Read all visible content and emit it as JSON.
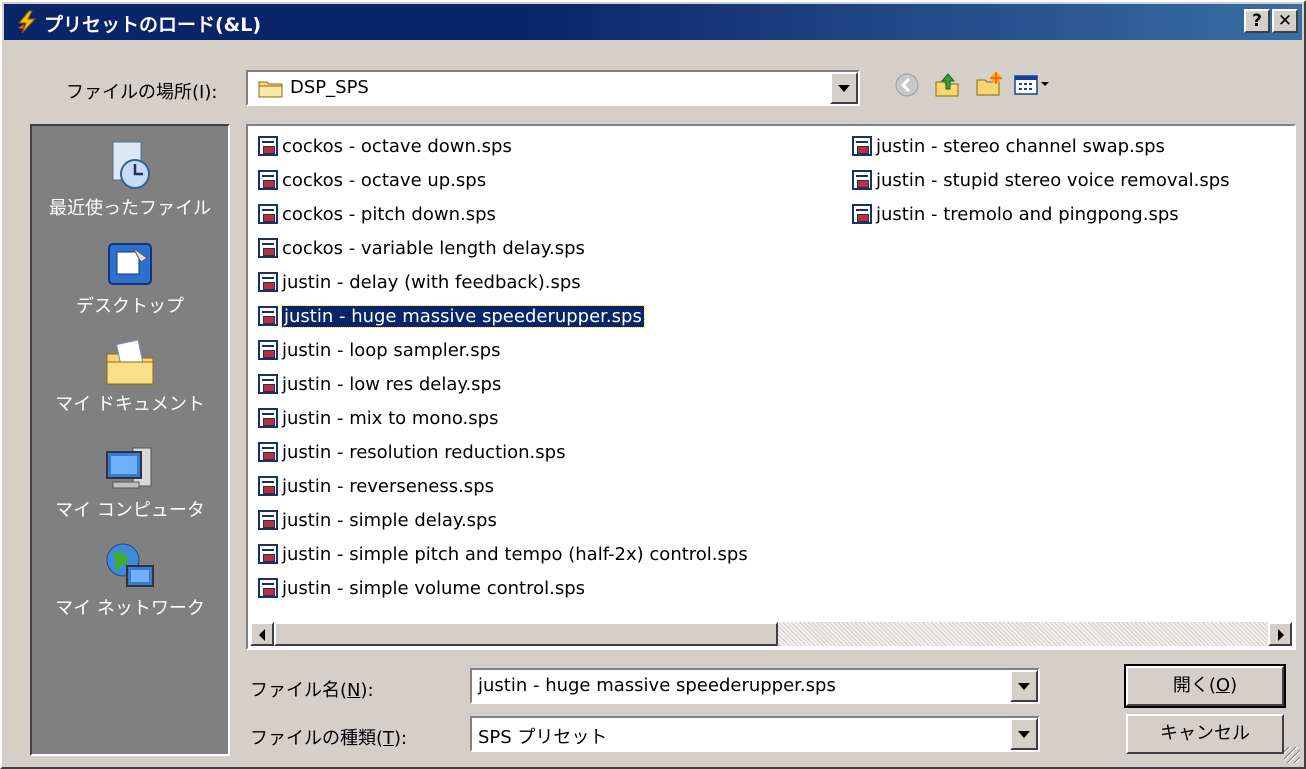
{
  "window": {
    "title": "プリセットのロード(&L)",
    "help_btn": "?",
    "close_btn": "✕"
  },
  "look_in": {
    "label": "ファイルの場所(I):",
    "value": "DSP_SPS"
  },
  "places": [
    {
      "label": "最近使ったファイル",
      "icon": "recent-files-icon"
    },
    {
      "label": "デスクトップ",
      "icon": "desktop-icon"
    },
    {
      "label": "マイ ドキュメント",
      "icon": "my-documents-icon"
    },
    {
      "label": "マイ コンピュータ",
      "icon": "my-computer-icon"
    },
    {
      "label": "マイ ネットワーク",
      "icon": "my-network-icon"
    }
  ],
  "files_col1": [
    "cockos - octave down.sps",
    "cockos - octave up.sps",
    "cockos - pitch down.sps",
    "cockos - variable length delay.sps",
    "justin - delay (with feedback).sps",
    "justin - huge massive speederupper.sps",
    "justin - loop sampler.sps",
    "justin - low res delay.sps",
    "justin - mix to mono.sps",
    "justin - resolution reduction.sps",
    "justin - reverseness.sps",
    "justin - simple delay.sps",
    "justin - simple pitch and tempo (half-2x) control.sps",
    "justin - simple volume control.sps"
  ],
  "files_col2": [
    "justin - stereo channel swap.sps",
    "justin - stupid stereo voice removal.sps",
    "justin - tremolo and pingpong.sps"
  ],
  "selected_file": "justin - huge massive speederupper.sps",
  "filename": {
    "label_text": "ファイル名(",
    "label_key": "N",
    "label_end": "):",
    "value": "justin - huge massive speederupper.sps"
  },
  "filetype": {
    "label_text": "ファイルの種類(",
    "label_key": "T",
    "label_end": "):",
    "value": "SPS プリセット"
  },
  "buttons": {
    "open_text": "開く(",
    "open_key": "O",
    "open_end": ")",
    "cancel": "キャンセル"
  }
}
